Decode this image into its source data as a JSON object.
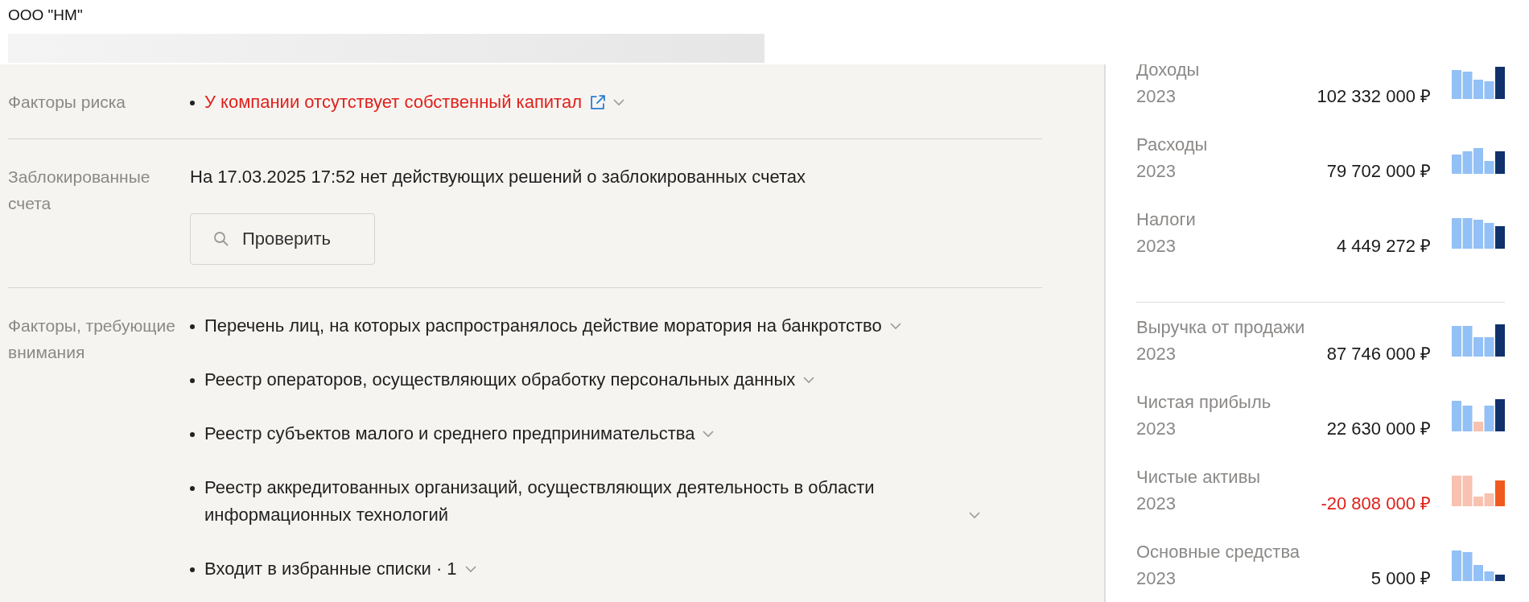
{
  "header": {
    "title": "ООО \"НМ\""
  },
  "sections": [
    {
      "label": "Факторы риска",
      "kind": "list",
      "items": [
        {
          "text": "У компании отсутствует собственный капитал",
          "risk": true,
          "link": true
        }
      ]
    },
    {
      "label": "Заблокированные счета",
      "kind": "note",
      "text": "На 17.03.2025 17:52 нет действующих решений о заблокированных счетах",
      "button": "Проверить"
    },
    {
      "label": "Факторы, требующие внимания",
      "kind": "list",
      "items": [
        {
          "text": "Перечень лиц, на которых распространялось действие моратория на банкротство",
          "risk": false,
          "link": false
        },
        {
          "text": "Реестр операторов, осуществляющих обработку персональных данных",
          "risk": false,
          "link": false
        },
        {
          "text": "Реестр субъектов малого и среднего предпринимательства",
          "risk": false,
          "link": false
        },
        {
          "text": "Реестр аккредитованных организаций, осуществляющих деятельность в области информационных технологий",
          "risk": false,
          "link": false
        },
        {
          "text": "Входит в избранные списки · 1",
          "risk": false,
          "link": false
        }
      ]
    }
  ],
  "finance_groups": [
    [
      {
        "label": "Доходы",
        "year": "2023",
        "value": "102 332 000 ₽",
        "negative": false
      },
      {
        "label": "Расходы",
        "year": "2023",
        "value": "79 702 000 ₽",
        "negative": false
      },
      {
        "label": "Налоги",
        "year": "2023",
        "value": "4 449 272 ₽",
        "negative": false
      }
    ],
    [
      {
        "label": "Выручка от продажи",
        "year": "2023",
        "value": "87 746 000 ₽",
        "negative": false
      },
      {
        "label": "Чистая прибыль",
        "year": "2023",
        "value": "22 630 000 ₽",
        "negative": false
      },
      {
        "label": "Чистые активы",
        "year": "2023",
        "value": "-20 808 000 ₽",
        "negative": true
      },
      {
        "label": "Основные средства",
        "year": "2023",
        "value": "5 000 ₽",
        "negative": false
      }
    ]
  ]
}
